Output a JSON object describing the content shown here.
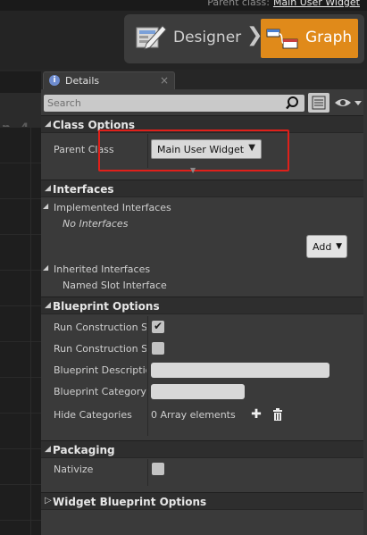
{
  "topbar": {
    "parent_class_label": "Parent class:",
    "parent_class_value": "Main User Widget"
  },
  "mode": {
    "designer_label": "Designer",
    "graph_label": "Graph",
    "chevron": "❯",
    "active": "Graph"
  },
  "graph_panel": {
    "zoom_text": "n -4"
  },
  "details_tab": {
    "label": "Details",
    "close": "×",
    "info_glyph": "i"
  },
  "search": {
    "placeholder": "Search",
    "value": ""
  },
  "sections": {
    "class_options": {
      "title": "Class Options",
      "parent_class_label": "Parent Class",
      "parent_class_value": "Main User Widget"
    },
    "interfaces": {
      "title": "Interfaces",
      "implemented_label": "Implemented Interfaces",
      "no_interfaces": "No Interfaces",
      "add_label": "Add",
      "inherited_label": "Inherited Interfaces",
      "named_slot": "Named Slot Interface"
    },
    "blueprint_options": {
      "title": "Blueprint Options",
      "run_construction_1": "Run Construction Scr",
      "run_construction_1_checked": true,
      "run_construction_2": "Run Construction Scr",
      "run_construction_2_checked": false,
      "description_label": "Blueprint Description",
      "description_value": "",
      "category_label": "Blueprint Category",
      "category_value": "",
      "hide_categories_label": "Hide Categories",
      "array_elements": "0 Array elements"
    },
    "packaging": {
      "title": "Packaging",
      "nativize_label": "Nativize",
      "nativize_checked": false
    },
    "widget_options": {
      "title": "Widget Blueprint Options"
    }
  },
  "colors": {
    "accent_orange": "#e08a1a",
    "highlight_red": "#e0201a",
    "panel_bg": "#3a3a3a"
  },
  "icons": [
    "designer-icon",
    "graph-icon",
    "info-icon",
    "search-icon",
    "list-view-icon",
    "eye-icon",
    "add-icon",
    "trash-icon"
  ]
}
